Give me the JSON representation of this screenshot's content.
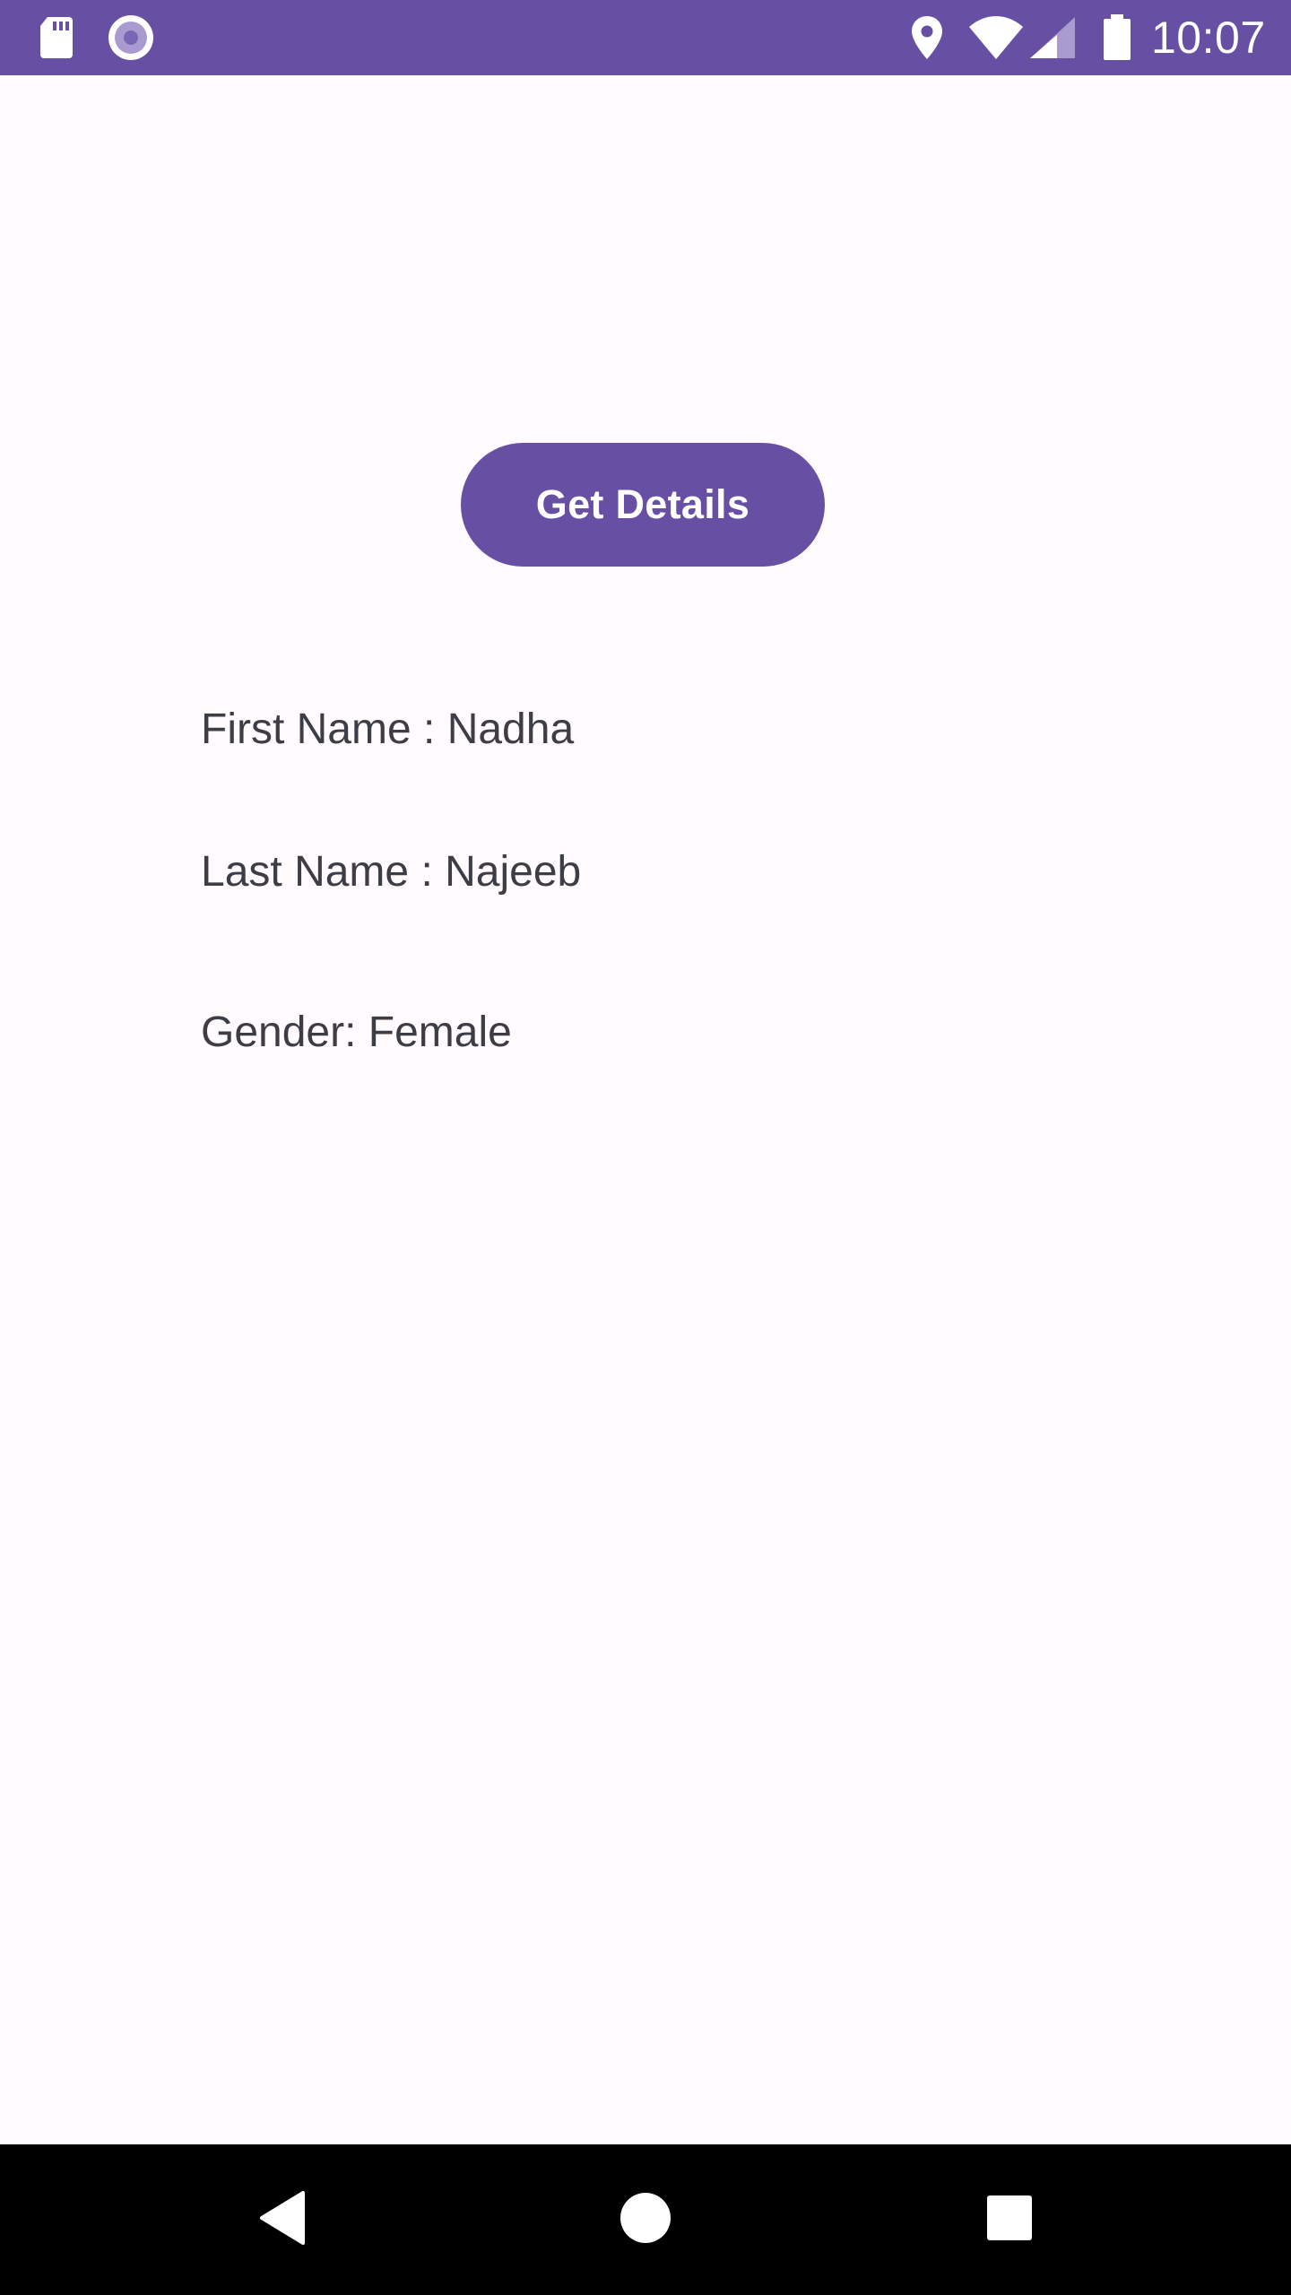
{
  "status_bar": {
    "time": "10:07",
    "background": "#6750A4",
    "icons": [
      "sd-card-icon",
      "record-icon",
      "location-icon",
      "wifi-icon",
      "signal-icon",
      "battery-icon"
    ]
  },
  "main": {
    "button_label": "Get Details",
    "first_name_line": "First Name : Nadha",
    "last_name_line": "Last Name : Najeeb",
    "gender_line": "Gender: Female"
  },
  "nav_bar": {
    "icons": [
      "back-icon",
      "home-icon",
      "recents-icon"
    ]
  },
  "colors": {
    "accent": "#6750A4",
    "background": "#FFFBFE",
    "text": "#3d3d45",
    "nav_background": "#000000"
  }
}
